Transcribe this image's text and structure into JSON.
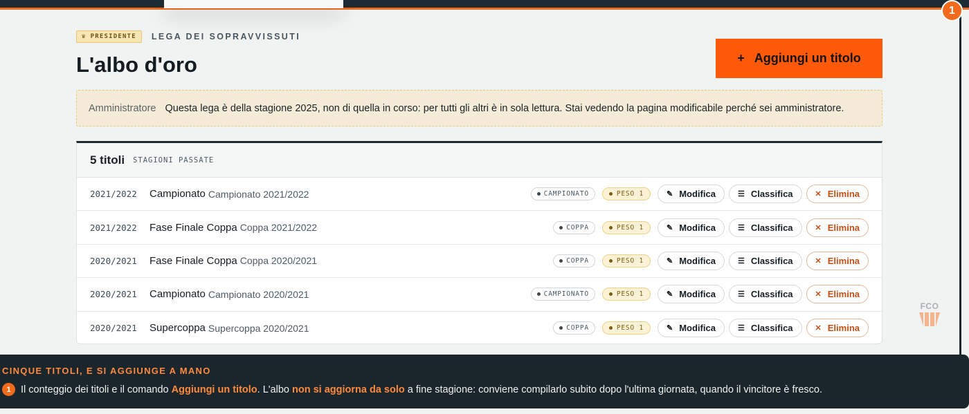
{
  "header": {
    "role_badge": "PRESIDENTE",
    "league_name": "LEGA DEI SOPRAVVISSUTI",
    "title": "L'albo d'oro",
    "add_button": "Aggiungi un titolo"
  },
  "notice": {
    "label": "Amministratore",
    "text": "Questa lega è della stagione 2025, non di quella in corso: per tutti gli altri è in sola lettura. Stai vedendo la pagina modificabile perché sei amministratore."
  },
  "card": {
    "count": "5 titoli",
    "subtitle": "STAGIONI PASSATE",
    "rows": [
      {
        "season": "2021/2022",
        "name": "Campionato",
        "detail": "Campionato 2021/2022",
        "type": "CAMPIONATO",
        "weight": "PESO 1"
      },
      {
        "season": "2021/2022",
        "name": "Fase Finale Coppa",
        "detail": "Coppa 2021/2022",
        "type": "COPPA",
        "weight": "PESO 1"
      },
      {
        "season": "2020/2021",
        "name": "Fase Finale Coppa",
        "detail": "Coppa 2020/2021",
        "type": "COPPA",
        "weight": "PESO 1"
      },
      {
        "season": "2020/2021",
        "name": "Campionato",
        "detail": "Campionato 2020/2021",
        "type": "CAMPIONATO",
        "weight": "PESO 1"
      },
      {
        "season": "2020/2021",
        "name": "Supercoppa",
        "detail": "Supercoppa 2020/2021",
        "type": "COPPA",
        "weight": "PESO 1"
      }
    ],
    "actions": {
      "edit": "Modifica",
      "standings": "Classifica",
      "delete": "Elimina"
    }
  },
  "logo": {
    "text": "FCO"
  },
  "tour": {
    "step_top": "1",
    "title": "CINQUE TITOLI, E SI AGGIUNGE A MANO",
    "step": "1",
    "body_1": "Il conteggio dei titoli e il comando",
    "highlight_1": "Aggiungi un titolo",
    "body_2": ". L'albo",
    "highlight_2": "non si aggiorna da solo",
    "body_3": "a fine stagione: conviene compilarlo subito dopo l'ultima giornata, quando il vincitore è fresco."
  },
  "colors": {
    "accent": "#ff5a0a",
    "dark": "#1d2b33",
    "gold": "#f8e6b3"
  }
}
